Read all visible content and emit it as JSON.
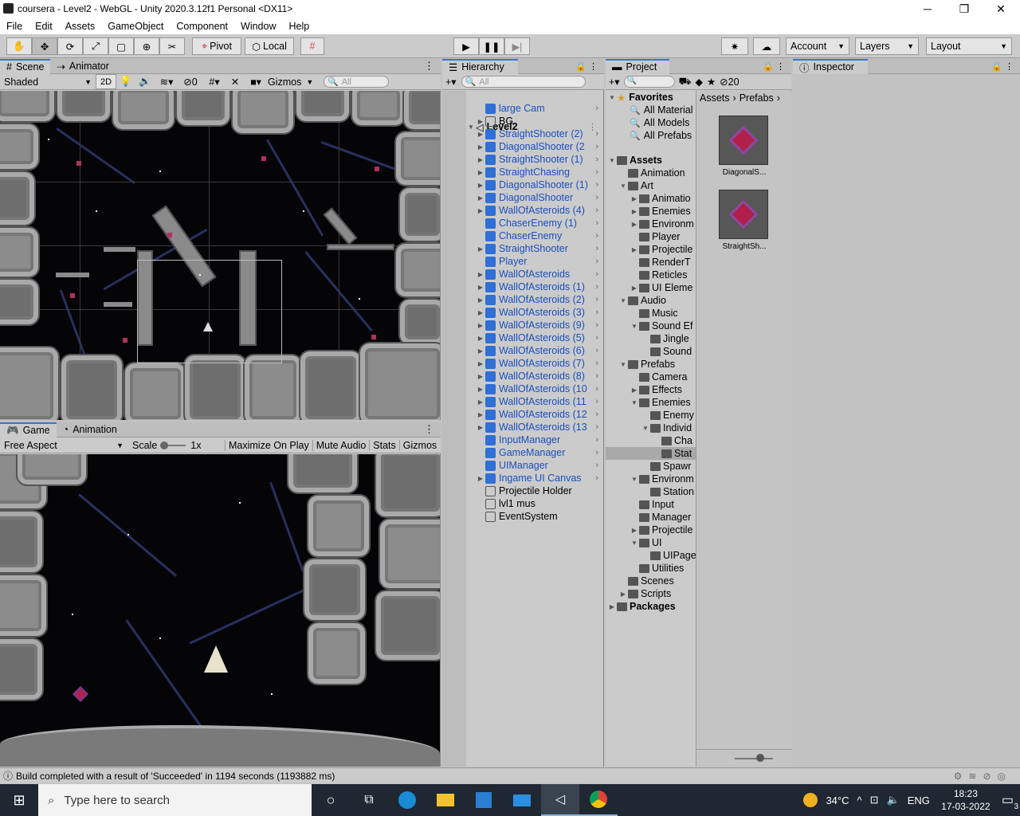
{
  "window": {
    "title": "coursera - Level2 - WebGL - Unity 2020.3.12f1 Personal <DX11>",
    "minimize": "─",
    "maximize": "❐",
    "close": "✕"
  },
  "menu": [
    "File",
    "Edit",
    "Assets",
    "GameObject",
    "Component",
    "Window",
    "Help"
  ],
  "toolbar": {
    "pivot": "Pivot",
    "local": "Local",
    "account": "Account",
    "layers": "Layers",
    "layout": "Layout"
  },
  "scene_panel": {
    "tabs": [
      "Scene",
      "Animator"
    ],
    "shading": "Shaded",
    "mode_2d": "2D",
    "hidden_count": "0",
    "gizmos": "Gizmos",
    "search_placeholder": "All"
  },
  "game_panel": {
    "tabs": [
      "Game",
      "Animation"
    ],
    "aspect": "Free Aspect",
    "scale_label": "Scale",
    "scale_value": "1x",
    "maximize": "Maximize On Play",
    "mute": "Mute Audio",
    "stats": "Stats",
    "gizmos": "Gizmos"
  },
  "hierarchy": {
    "title": "Hierarchy",
    "search_placeholder": "All",
    "scene_name": "Level2",
    "items": [
      {
        "label": "large Cam",
        "prefab": true,
        "expand": false
      },
      {
        "label": "BG",
        "prefab": false,
        "expand": true
      },
      {
        "label": "StraightShooter (2)",
        "prefab": true,
        "expand": true
      },
      {
        "label": "DiagonalShooter (2",
        "prefab": true,
        "expand": true
      },
      {
        "label": "StraightShooter (1)",
        "prefab": true,
        "expand": true
      },
      {
        "label": "StraightChasing",
        "prefab": true,
        "expand": true
      },
      {
        "label": "DiagonalShooter (1)",
        "prefab": true,
        "expand": true
      },
      {
        "label": "DiagonalShooter",
        "prefab": true,
        "expand": true
      },
      {
        "label": "WallOfAsteroids (4)",
        "prefab": true,
        "expand": true
      },
      {
        "label": "ChaserEnemy (1)",
        "prefab": true,
        "expand": false
      },
      {
        "label": "ChaserEnemy",
        "prefab": true,
        "expand": false
      },
      {
        "label": "StraightShooter",
        "prefab": true,
        "expand": true
      },
      {
        "label": "Player",
        "prefab": true,
        "expand": false
      },
      {
        "label": "WallOfAsteroids",
        "prefab": true,
        "expand": true
      },
      {
        "label": "WallOfAsteroids (1)",
        "prefab": true,
        "expand": true
      },
      {
        "label": "WallOfAsteroids (2)",
        "prefab": true,
        "expand": true
      },
      {
        "label": "WallOfAsteroids (3)",
        "prefab": true,
        "expand": true
      },
      {
        "label": "WallOfAsteroids (9)",
        "prefab": true,
        "expand": true
      },
      {
        "label": "WallOfAsteroids (5)",
        "prefab": true,
        "expand": true
      },
      {
        "label": "WallOfAsteroids (6)",
        "prefab": true,
        "expand": true
      },
      {
        "label": "WallOfAsteroids (7)",
        "prefab": true,
        "expand": true
      },
      {
        "label": "WallOfAsteroids (8)",
        "prefab": true,
        "expand": true
      },
      {
        "label": "WallOfAsteroids (10",
        "prefab": true,
        "expand": true
      },
      {
        "label": "WallOfAsteroids (11",
        "prefab": true,
        "expand": true
      },
      {
        "label": "WallOfAsteroids (12",
        "prefab": true,
        "expand": true
      },
      {
        "label": "WallOfAsteroids (13",
        "prefab": true,
        "expand": true
      },
      {
        "label": "InputManager",
        "prefab": true,
        "expand": false
      },
      {
        "label": "GameManager",
        "prefab": true,
        "expand": false
      },
      {
        "label": "UIManager",
        "prefab": true,
        "expand": false
      },
      {
        "label": "Ingame UI Canvas",
        "prefab": true,
        "expand": true
      },
      {
        "label": "Projectile Holder",
        "prefab": false,
        "expand": false
      },
      {
        "label": "lvl1 mus",
        "prefab": false,
        "expand": false
      },
      {
        "label": "EventSystem",
        "prefab": false,
        "expand": false
      }
    ]
  },
  "project": {
    "title": "Project",
    "hidden_count": "20",
    "breadcrumb": [
      "Assets",
      "Prefabs"
    ],
    "favorites_label": "Favorites",
    "favorites": [
      "All Material",
      "All Models",
      "All Prefabs"
    ],
    "tree": [
      {
        "label": "Assets",
        "depth": 0,
        "arrow": "down",
        "bold": true
      },
      {
        "label": "Animation",
        "depth": 1,
        "arrow": "none"
      },
      {
        "label": "Art",
        "depth": 1,
        "arrow": "down"
      },
      {
        "label": "Animatio",
        "depth": 2,
        "arrow": "right"
      },
      {
        "label": "Enemies",
        "depth": 2,
        "arrow": "right"
      },
      {
        "label": "Environm",
        "depth": 2,
        "arrow": "right"
      },
      {
        "label": "Player",
        "depth": 2,
        "arrow": "none"
      },
      {
        "label": "Projectile",
        "depth": 2,
        "arrow": "right"
      },
      {
        "label": "RenderT",
        "depth": 2,
        "arrow": "none"
      },
      {
        "label": "Reticles",
        "depth": 2,
        "arrow": "none"
      },
      {
        "label": "UI Eleme",
        "depth": 2,
        "arrow": "right"
      },
      {
        "label": "Audio",
        "depth": 1,
        "arrow": "down"
      },
      {
        "label": "Music",
        "depth": 2,
        "arrow": "none"
      },
      {
        "label": "Sound Ef",
        "depth": 2,
        "arrow": "down"
      },
      {
        "label": "Jingle",
        "depth": 3,
        "arrow": "none"
      },
      {
        "label": "Sound",
        "depth": 3,
        "arrow": "none"
      },
      {
        "label": "Prefabs",
        "depth": 1,
        "arrow": "down"
      },
      {
        "label": "Camera",
        "depth": 2,
        "arrow": "none"
      },
      {
        "label": "Effects",
        "depth": 2,
        "arrow": "right"
      },
      {
        "label": "Enemies",
        "depth": 2,
        "arrow": "down"
      },
      {
        "label": "Enemy",
        "depth": 3,
        "arrow": "none"
      },
      {
        "label": "Individ",
        "depth": 3,
        "arrow": "down"
      },
      {
        "label": "Cha",
        "depth": 4,
        "arrow": "none"
      },
      {
        "label": "Stat",
        "depth": 4,
        "arrow": "none",
        "selected": true
      },
      {
        "label": "Spawr",
        "depth": 3,
        "arrow": "none"
      },
      {
        "label": "Environm",
        "depth": 2,
        "arrow": "down"
      },
      {
        "label": "Station",
        "depth": 3,
        "arrow": "none"
      },
      {
        "label": "Input",
        "depth": 2,
        "arrow": "none"
      },
      {
        "label": "Manager",
        "depth": 2,
        "arrow": "none"
      },
      {
        "label": "Projectile",
        "depth": 2,
        "arrow": "right"
      },
      {
        "label": "UI",
        "depth": 2,
        "arrow": "down"
      },
      {
        "label": "UIPage",
        "depth": 3,
        "arrow": "none"
      },
      {
        "label": "Utilities",
        "depth": 2,
        "arrow": "none"
      },
      {
        "label": "Scenes",
        "depth": 1,
        "arrow": "none"
      },
      {
        "label": "Scripts",
        "depth": 1,
        "arrow": "right"
      },
      {
        "label": "Packages",
        "depth": 0,
        "arrow": "right",
        "bold": true
      }
    ],
    "assets": [
      {
        "label": "DiagonalS..."
      },
      {
        "label": "StraightSh..."
      }
    ]
  },
  "inspector": {
    "title": "Inspector"
  },
  "status": {
    "message": "Build completed with a result of 'Succeeded' in 1194 seconds (1193882 ms)"
  },
  "taskbar": {
    "search_placeholder": "Type here to search",
    "temperature": "34°C",
    "language": "ENG",
    "time": "18:23",
    "date": "17-03-2022",
    "notifications": "3"
  }
}
